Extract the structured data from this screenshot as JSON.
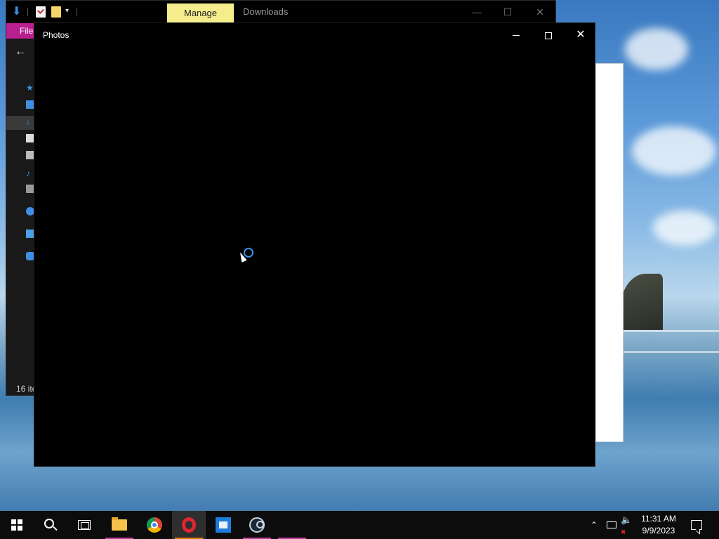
{
  "file_explorer": {
    "ribbon": {
      "manage_tab_label": "Manage",
      "file_tab_label": "File"
    },
    "window_title": "Downloads",
    "status_bar_text": "16 ite"
  },
  "photos_window": {
    "title": "Photos",
    "state": "loading"
  },
  "taskbar": {
    "pinned_apps": [
      {
        "icon": "windows-start-icon"
      },
      {
        "icon": "search-icon"
      },
      {
        "icon": "task-view-icon"
      },
      {
        "icon": "file-explorer-icon",
        "active": true,
        "accent": "#c040a0"
      },
      {
        "icon": "chrome-icon"
      },
      {
        "icon": "opera-icon",
        "active": true,
        "accent": "#e07a00"
      },
      {
        "icon": "virtualbox-icon"
      },
      {
        "icon": "steam-icon",
        "accent": "#c040a0"
      }
    ],
    "tray": {
      "icons": [
        "chevron-up-icon",
        "network-icon",
        "volume-muted-icon"
      ],
      "time": "11:31 AM",
      "date": "9/9/2023"
    }
  },
  "colors": {
    "manage_tab": "#f5ec8c",
    "file_tab": "#b8208f",
    "accent_blue": "#3d8fe6"
  }
}
